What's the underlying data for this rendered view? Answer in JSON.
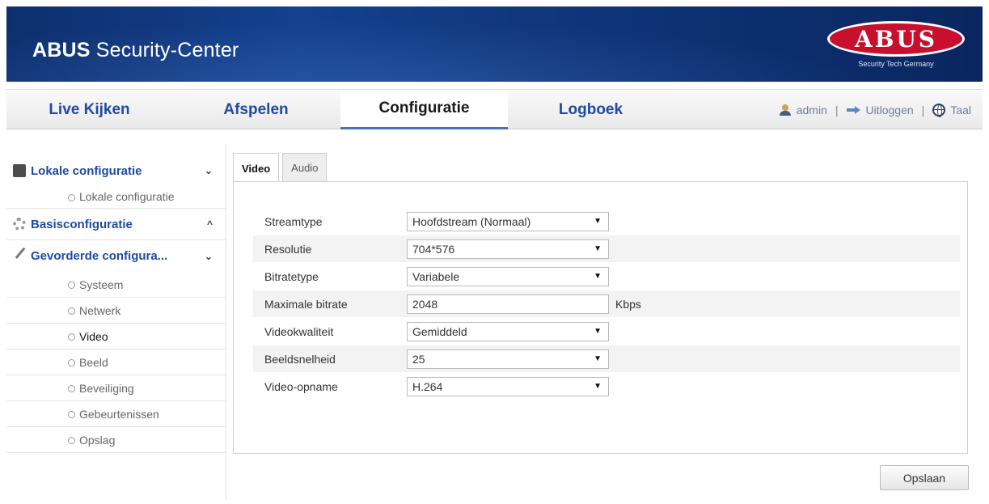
{
  "header": {
    "title_bold": "ABUS",
    "title_rest": " Security-Center",
    "logo_text": "ABUS",
    "logo_tagline": "Security Tech Germany"
  },
  "nav": {
    "tabs": [
      "Live Kijken",
      "Afspelen",
      "Configuratie",
      "Logboek"
    ],
    "active_tab": "Configuratie",
    "user": "admin",
    "logout": "Uitloggen",
    "language": "Taal",
    "separator": "|"
  },
  "sidebar": {
    "sections": [
      {
        "label": "Lokale configuratie",
        "icon": "monitor-icon",
        "chevron": "⌄",
        "items": [
          "Lokale configuratie"
        ]
      },
      {
        "label": "Basisconfiguratie",
        "icon": "gear-icon",
        "chevron": "^"
      },
      {
        "label": "Gevorderde configura...",
        "icon": "wrench-icon",
        "chevron": "⌄",
        "items": [
          "Systeem",
          "Netwerk",
          "Video",
          "Beeld",
          "Beveiliging",
          "Gebeurtenissen",
          "Opslag"
        ]
      }
    ],
    "active_item": "Video"
  },
  "content": {
    "tabs": [
      "Video",
      "Audio"
    ],
    "active_tab": "Video",
    "fields": {
      "streamtype": {
        "label": "Streamtype",
        "value": "Hoofdstream (Normaal)"
      },
      "resolutie": {
        "label": "Resolutie",
        "value": "704*576"
      },
      "bitratetype": {
        "label": "Bitratetype",
        "value": "Variabele"
      },
      "max_bitrate": {
        "label": "Maximale bitrate",
        "value": "2048",
        "unit": "Kbps"
      },
      "videokwaliteit": {
        "label": "Videokwaliteit",
        "value": "Gemiddeld"
      },
      "beeldsnelheid": {
        "label": "Beeldsnelheid",
        "value": "25"
      },
      "video_opname": {
        "label": "Video-opname",
        "value": "H.264"
      }
    },
    "dropdown_arrow": "▼",
    "save_label": "Opslaan"
  },
  "colors": {
    "banner": "#14408e",
    "nav_link": "#1f4aa3",
    "logo_red": "#c8102e"
  }
}
